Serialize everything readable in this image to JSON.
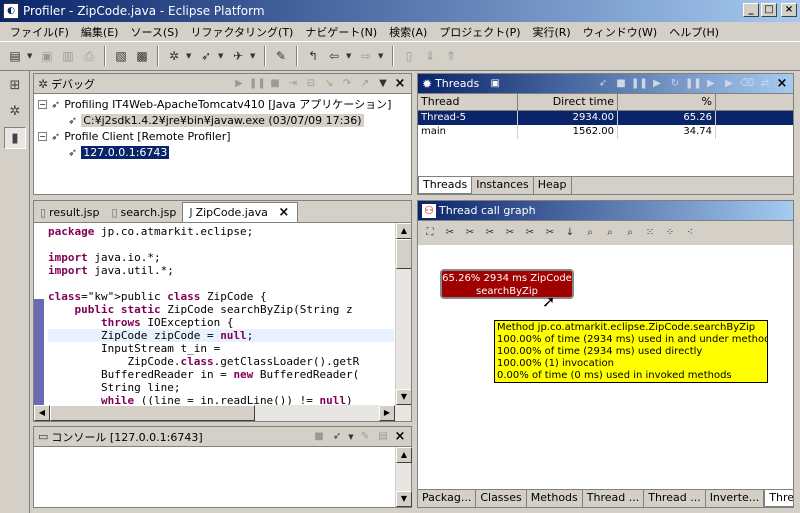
{
  "window": {
    "title": "Profiler - ZipCode.java - Eclipse Platform"
  },
  "menu": [
    "ファイル(F)",
    "編集(E)",
    "ソース(S)",
    "リファクタリング(T)",
    "ナビゲート(N)",
    "検索(A)",
    "プロジェクト(P)",
    "実行(R)",
    "ウィンドウ(W)",
    "ヘルプ(H)"
  ],
  "debug": {
    "title": "デバッグ",
    "tree": [
      {
        "label": "Profiling IT4Web-ApacheTomcatv410 [Java アプリケーション]",
        "level": 0
      },
      {
        "label": "C:¥j2sdk1.4.2¥jre¥bin¥javaw.exe (03/07/09 17:36)",
        "level": 1
      },
      {
        "label": "Profile Client [Remote Profiler]",
        "level": 0
      },
      {
        "label": "127.0.0.1:6743",
        "level": 1
      }
    ]
  },
  "threads": {
    "title": "Threads",
    "columns": [
      "Thread",
      "Direct time",
      "%"
    ],
    "rows": [
      {
        "name": "Thread-5",
        "time": "2934.00",
        "pct": "65.26"
      },
      {
        "name": "main",
        "time": "1562.00",
        "pct": "34.74"
      }
    ],
    "tabs": [
      "Threads",
      "Instances",
      "Heap"
    ]
  },
  "editor": {
    "tabs": [
      "result.jsp",
      "search.jsp",
      "ZipCode.java"
    ],
    "code": [
      {
        "t": "package jp.co.atmarkit.eclipse;",
        "k": [
          "package"
        ]
      },
      {
        "t": "",
        "k": []
      },
      {
        "t": "import java.io.*;",
        "k": [
          "import"
        ]
      },
      {
        "t": "import java.util.*;",
        "k": [
          "import"
        ]
      },
      {
        "t": "",
        "k": []
      },
      {
        "t": "public class ZipCode {",
        "k": [
          "public",
          "class"
        ]
      },
      {
        "t": "    public static ZipCode searchByZip(String z",
        "k": [
          "public",
          "static"
        ]
      },
      {
        "t": "        throws IOException {",
        "k": [
          "throws"
        ]
      },
      {
        "t": "        ZipCode zipCode = null;",
        "k": [
          "null"
        ]
      },
      {
        "t": "        InputStream t_in =",
        "k": []
      },
      {
        "t": "            ZipCode.class.getClassLoader().getR",
        "k": [
          "class"
        ]
      },
      {
        "t": "        BufferedReader in = new BufferedReader(",
        "k": [
          "new"
        ]
      },
      {
        "t": "        String line;",
        "k": []
      },
      {
        "t": "        while ((line = in.readLine()) != null)",
        "k": [
          "while",
          "null"
        ]
      }
    ]
  },
  "console": {
    "title": "コンソール [127.0.0.1:6743]"
  },
  "callgraph": {
    "title": "Thread call graph",
    "node": {
      "line1": "65.26% 2934 ms ZipCode",
      "line2": "searchByZip"
    },
    "tooltip": [
      "Method jp.co.atmarkit.eclipse.ZipCode.searchByZip",
      "100.00% of time (2934 ms) used in and under method",
      "100.00% of time (2934 ms) used directly",
      "100.00% (1) invocation",
      "0.00% of time (0 ms) used in invoked methods"
    ],
    "tabs": [
      "Packag...",
      "Classes",
      "Methods",
      "Thread ...",
      "Thread ...",
      "Inverte...",
      "Threa"
    ]
  }
}
